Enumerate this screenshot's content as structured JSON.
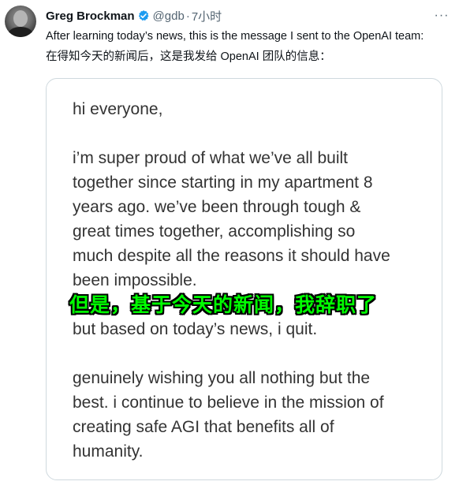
{
  "author": {
    "name": "Greg Brockman",
    "handle": "@gdb",
    "separator": "·",
    "time": "7小时"
  },
  "more_button": {
    "icon": "more-horizontal-icon",
    "label": "···"
  },
  "tweet": {
    "text_en": "After learning today’s news, this is the message I sent to the OpenAI team:",
    "text_zh": "在得知今天的新闻后，这是我发给 OpenAI 团队的信息："
  },
  "image_card": {
    "greeting": "hi everyone,",
    "paragraph1": [
      "i’m super proud of what we’ve all built",
      "together since starting in my apartment 8",
      "years ago. we’ve been through tough &",
      "great times together, accomplishing so",
      "much despite all the reasons it should have",
      "been impossible."
    ],
    "paragraph2": "but based on today’s news, i quit.",
    "paragraph3": [
      "genuinely wishing you all nothing but the",
      "best. i continue to believe in the mission of",
      "creating safe AGI that benefits all of",
      "humanity."
    ],
    "caption_overlay": "但是，基于今天的新闻，我辞职了"
  },
  "colors": {
    "verified_badge": "#1d9bf0",
    "secondary_text": "#536471",
    "caption_green": "#00ff00"
  }
}
